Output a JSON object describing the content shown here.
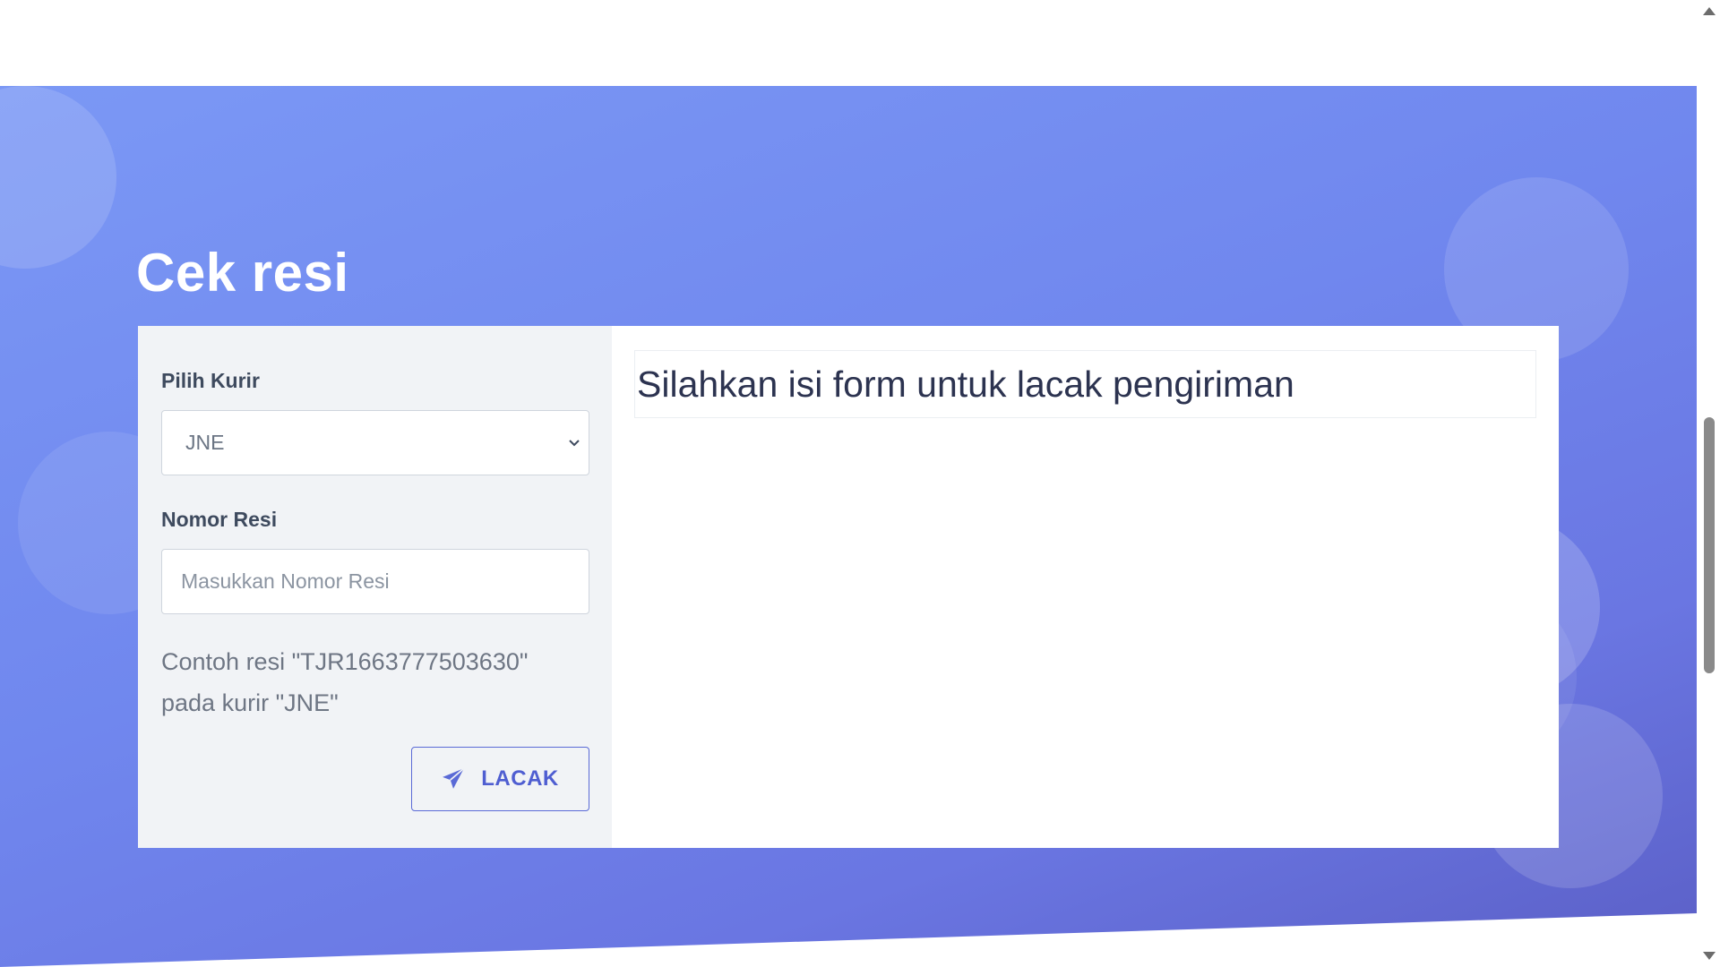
{
  "hero": {
    "title": "Cek resi"
  },
  "form": {
    "courier_label": "Pilih Kurir",
    "courier_selected": "JNE",
    "receipt_label": "Nomor Resi",
    "receipt_value": "",
    "receipt_placeholder": "Masukkan Nomor Resi",
    "hint_line1": "Contoh resi \"TJR1663777503630\"",
    "hint_line2": "pada kurir \"JNE\"",
    "submit_label": "LACAK",
    "submit_icon": "paper-plane-icon"
  },
  "result": {
    "message": "Silahkan isi form untuk lacak pengiriman"
  },
  "colors": {
    "accent": "#5a6ad6",
    "hero_gradient_start": "#7b98f5",
    "hero_gradient_end": "#5b5fc6"
  }
}
